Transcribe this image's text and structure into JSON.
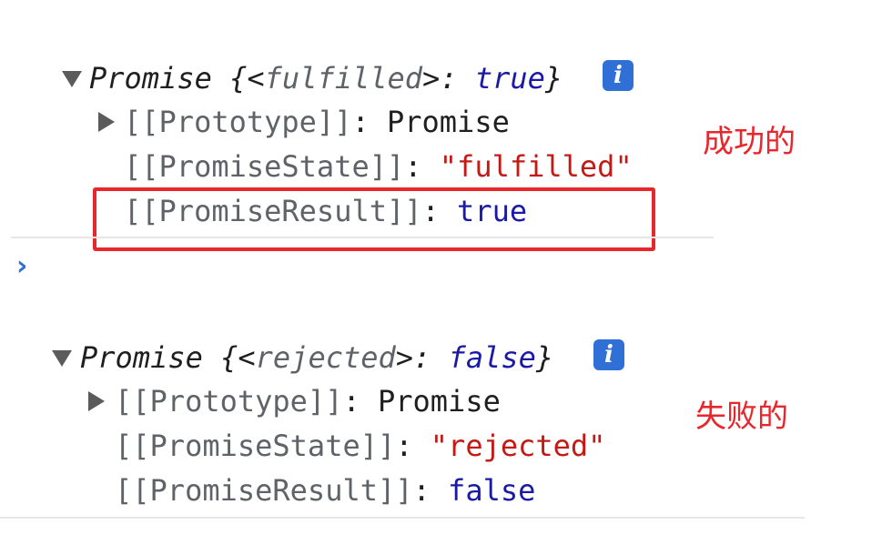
{
  "block1": {
    "header": {
      "name": "Promise",
      "open": " {<",
      "state": "fulfilled",
      "mid": ">: ",
      "value": "true",
      "close": "}"
    },
    "info_icon_glyph": "i",
    "prototype_key": "[[Prototype]]",
    "prototype_sep": ": ",
    "prototype_value": "Promise",
    "state_key": "[[PromiseState]]",
    "state_sep": ": ",
    "state_value": "\"fulfilled\"",
    "result_key": "[[PromiseResult]]",
    "result_sep": ": ",
    "result_value": "true"
  },
  "annotation1": "成功的",
  "console_prompt": "›",
  "block2": {
    "header": {
      "name": "Promise",
      "open": " {<",
      "state": "rejected",
      "mid": ">: ",
      "value": "false",
      "close": "}"
    },
    "info_icon_glyph": "i",
    "prototype_key": "[[Prototype]]",
    "prototype_sep": ": ",
    "prototype_value": "Promise",
    "state_key": "[[PromiseState]]",
    "state_sep": ": ",
    "state_value": "\"rejected\"",
    "result_key": "[[PromiseResult]]",
    "result_sep": ": ",
    "result_value": "false"
  },
  "annotation2": "失败的",
  "colors": {
    "annotation": "#e8262c",
    "string_value": "#c41a16",
    "boolean_value": "#1a1aa6",
    "key": "#5f6368",
    "info_icon_bg": "#2f6fd6",
    "prompt": "#2f6fd6"
  },
  "icons": {
    "expand_open": "triangle-down-icon",
    "expand_closed": "triangle-right-icon",
    "info": "info-icon",
    "prompt": "chevron-right-icon"
  }
}
